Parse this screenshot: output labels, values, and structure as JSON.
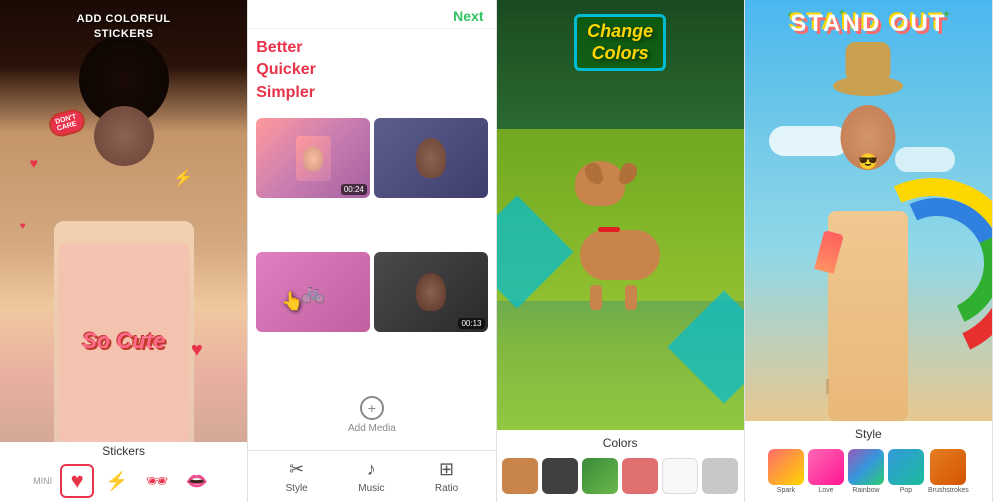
{
  "panels": [
    {
      "id": "stickers",
      "top_label": "ADD COLORFUL\nSTICKERS",
      "bottom_label": "Stickers",
      "stickers": {
        "dont_care": "DON'T\nCARE",
        "so_cute": "So Cute",
        "bolt": "⚡",
        "heart": "♥"
      },
      "toolbar_items": [
        {
          "label": "MINI",
          "type": "text"
        },
        {
          "label": "♥",
          "type": "heart",
          "selected": true
        },
        {
          "label": "⚡",
          "type": "bolt"
        },
        {
          "label": "🕶",
          "type": "glasses"
        },
        {
          "label": "👄",
          "type": "lips"
        }
      ]
    },
    {
      "id": "media",
      "next_label": "Next",
      "promo_text": "Better\nQuicker\nSimpler",
      "add_media_label": "Add Media",
      "thumbnails": [
        {
          "duration": "00:24",
          "type": "portrait"
        },
        {
          "duration": "",
          "type": "portrait2"
        },
        {
          "duration": "",
          "type": "cycling",
          "has_cursor": true
        },
        {
          "duration": "00:13",
          "type": "person"
        }
      ],
      "toolbar": [
        {
          "icon": "✂",
          "label": "Style"
        },
        {
          "icon": "♪",
          "label": "Music"
        },
        {
          "icon": "⊞",
          "label": "Ratio"
        }
      ]
    },
    {
      "id": "colors",
      "change_colors_text": "Change\nColors",
      "bottom_label": "Colors",
      "swatches": [
        {
          "color": "#c8844a"
        },
        {
          "color": "#555555"
        },
        {
          "color": "#3a7a3a"
        },
        {
          "color": "#e08080"
        },
        {
          "color": "#f0f0f0"
        },
        {
          "color": "#dddddd"
        }
      ]
    },
    {
      "id": "style",
      "stand_out_text": "STAND OUT",
      "bottom_label": "Style",
      "swatches": [
        {
          "label": "Spark",
          "color": "#ff6b6b"
        },
        {
          "label": "Love",
          "color": "#ff69b4"
        },
        {
          "label": "Rainbow",
          "color": "#9b59b6"
        },
        {
          "label": "Pop",
          "color": "#3498db"
        },
        {
          "label": "Brushstrokes",
          "color": "#e67e22"
        }
      ]
    }
  ]
}
